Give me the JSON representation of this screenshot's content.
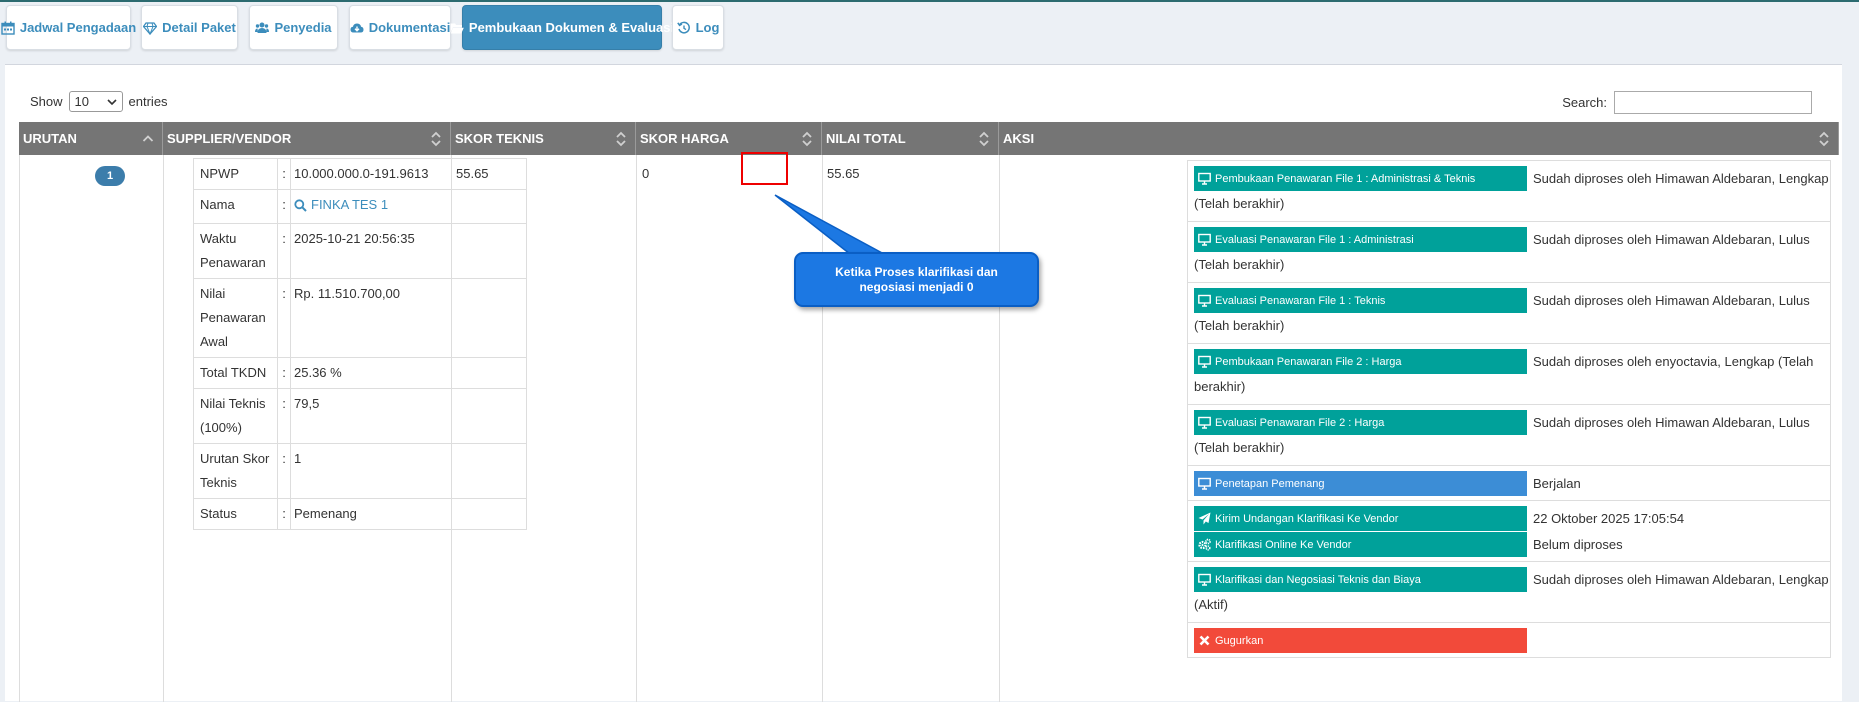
{
  "tabs": [
    {
      "label": "Jadwal Pengadaan",
      "icon": "calendar-icon"
    },
    {
      "label": "Detail Paket",
      "icon": "diamond-icon"
    },
    {
      "label": "Penyedia",
      "icon": "users-icon"
    },
    {
      "label": "Dokumentasi",
      "icon": "cloud-download-icon"
    },
    {
      "label": "Pembukaan Dokumen & Evaluasi",
      "icon": "folder-open-icon",
      "active": true
    },
    {
      "label": "Log",
      "icon": "history-icon"
    }
  ],
  "controls": {
    "show_label": "Show",
    "entries_value": "10",
    "entries_label": "entries",
    "search_label": "Search:"
  },
  "table": {
    "headers": [
      "URUTAN",
      "SUPPLIER/VENDOR",
      "SKOR TEKNIS",
      "SKOR HARGA",
      "NILAI TOTAL",
      "AKSI"
    ],
    "row": {
      "urutan": "1",
      "skor_teknis": "55.65",
      "skor_harga": "0",
      "nilai_total": "55.65",
      "vendor_info": [
        {
          "key": "NPWP",
          "value": "10.000.000.0-191.9613"
        },
        {
          "key": "Nama",
          "value": "FINKA TES 1"
        },
        {
          "key": "Waktu Penawaran",
          "value": "2025-10-21 20:56:35"
        },
        {
          "key": "Nilai Penawaran Awal",
          "value": "Rp. 11.510.700,00"
        },
        {
          "key": "Total TKDN",
          "value": "25.36 %"
        },
        {
          "key": "Nilai Teknis (100%)",
          "value": "79,5"
        },
        {
          "key": "Urutan Skor Teknis",
          "value": "1"
        },
        {
          "key": "Status",
          "value": "Pemenang"
        }
      ]
    }
  },
  "callout": {
    "text": "Ketika Proses klarifikasi dan negosiasi menjadi 0"
  },
  "aksi": [
    {
      "label": "Pembukaan Penawaran File 1 : Administrasi & Teknis",
      "status": "Sudah diproses oleh Himawan Aldebaran, Lengkap",
      "cont": "(Telah berakhir)"
    },
    {
      "label": "Evaluasi Penawaran File 1 : Administrasi",
      "status": "Sudah diproses oleh Himawan Aldebaran, Lulus",
      "cont": "(Telah berakhir)"
    },
    {
      "label": "Evaluasi Penawaran File 1 : Teknis",
      "status": "Sudah diproses oleh Himawan Aldebaran, Lulus",
      "cont": "(Telah berakhir)"
    },
    {
      "label": "Pembukaan Penawaran File 2 : Harga",
      "status": "Sudah diproses oleh enyoctavia, Lengkap (Telah",
      "cont": "berakhir)"
    },
    {
      "label": "Evaluasi Penawaran File 2 : Harga",
      "status": "Sudah diproses oleh Himawan Aldebaran, Lulus",
      "cont": "(Telah berakhir)"
    },
    {
      "label": "Penetapan Pemenang",
      "status": "Berjalan"
    },
    {
      "label": "Kirim Undangan Klarifikasi Ke Vendor",
      "status": "22 Oktober 2025 17:05:54"
    },
    {
      "label": "Klarifikasi Online Ke Vendor",
      "status": "Belum diproses"
    },
    {
      "label": "Klarifikasi dan Negosiasi Teknis dan Biaya",
      "status": "Sudah diproses oleh Himawan Aldebaran, Lengkap",
      "cont": "(Aktif)"
    },
    {
      "label": "Gugurkan"
    }
  ],
  "colors": {
    "accent": "#3c8dbc",
    "teal": "#00a19a",
    "blue": "#3c8dd6",
    "red": "#f24a3a",
    "header": "#757575",
    "callout": "#1c78e3"
  }
}
